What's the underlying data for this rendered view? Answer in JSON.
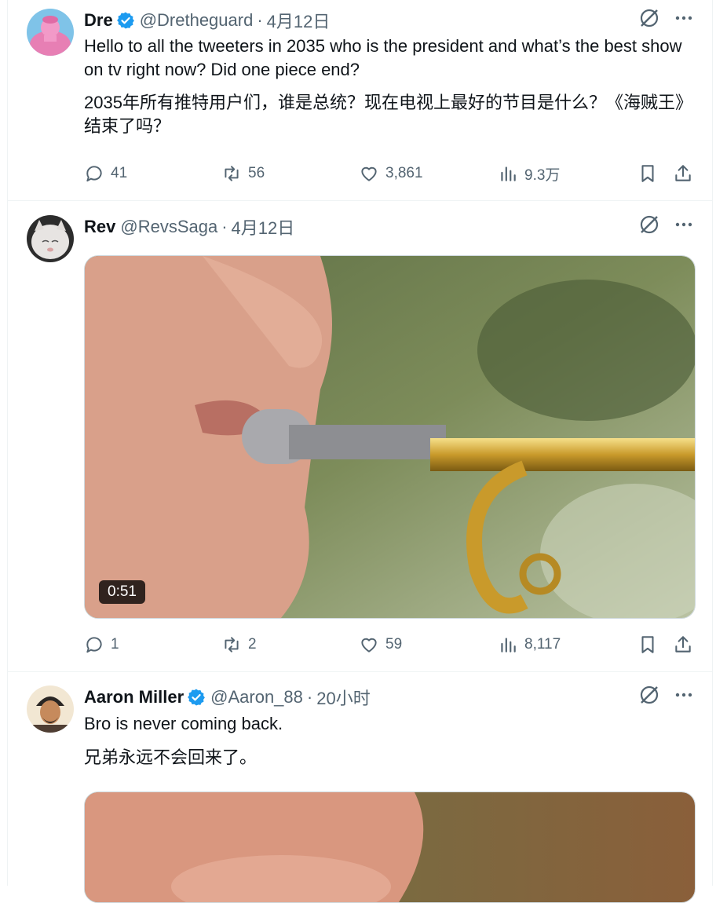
{
  "tweets": [
    {
      "name": "Dre",
      "verified": true,
      "handle": "@Dretheguard",
      "time": "4月12日",
      "text_en": "Hello to all the tweeters in 2035 who is the president and what’s the best show on tv right now? Did one piece end?",
      "text_zh": "2035年所有推特用户们，谁是总统？现在电视上最好的节目是什么？《海贼王》结束了吗？",
      "replies": "41",
      "reposts": "56",
      "likes": "3,861",
      "views": "9.3万"
    },
    {
      "name": "Rev",
      "verified": false,
      "handle": "@RevsSaga",
      "time": "4月12日",
      "video_duration": "0:51",
      "replies": "1",
      "reposts": "2",
      "likes": "59",
      "views": "8,117"
    },
    {
      "name": "Aaron Miller",
      "verified": true,
      "handle": "@Aaron_88",
      "time": "20小时",
      "text_en": "Bro is never coming back.",
      "text_zh": "兄弟永远不会回来了。"
    }
  ],
  "colors": {
    "verified_blue": "#1d9bf0",
    "secondary_text": "#536471",
    "divider": "#eff3f4"
  },
  "icons": [
    "grok-icon",
    "more-icon",
    "reply-icon",
    "repost-icon",
    "like-icon",
    "views-icon",
    "bookmark-icon",
    "share-icon",
    "verified-badge-icon"
  ]
}
